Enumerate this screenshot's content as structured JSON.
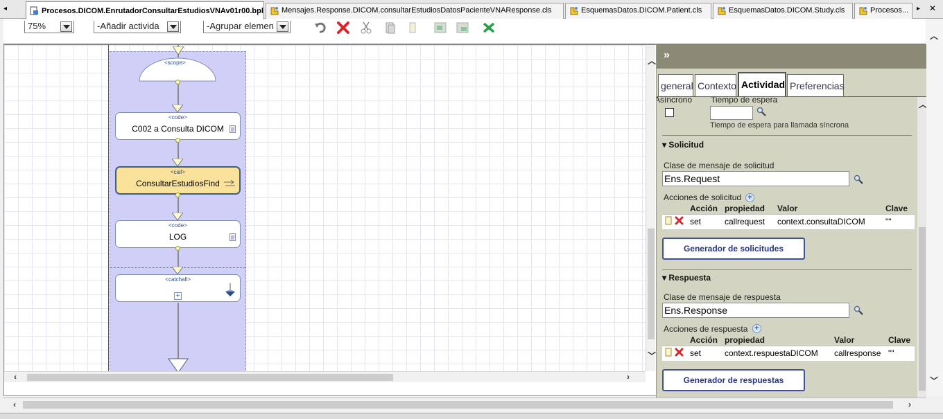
{
  "tabs": {
    "items": [
      {
        "label": "Procesos.DICOM.EnrutadorConsultarEstudiosVNAv01r00.bpl",
        "active": true
      },
      {
        "label": "Mensajes.Response.DICOM.consultarEstudiosDatosPacienteVNAResponse.cls",
        "active": false
      },
      {
        "label": "EsquemasDatos.DICOM.Patient.cls",
        "active": false
      },
      {
        "label": "EsquemasDatos.DICOM.Study.cls",
        "active": false
      },
      {
        "label": "Procesos...",
        "active": false
      }
    ],
    "nav_left": "◂",
    "nav_right": "▸",
    "close": "✕"
  },
  "toolbar": {
    "zoom_value": "75%",
    "add_activity_value": "-Añadir activida",
    "group_value": "-Agrupar elemen",
    "icons": [
      "undo-icon",
      "delete-icon",
      "cut-icon",
      "copy-icon",
      "paste-icon",
      "group-icon",
      "ungroup-icon",
      "arrange-icon"
    ]
  },
  "diagram": {
    "scope": {
      "stereotype": "<scope>"
    },
    "activities": [
      {
        "stereotype": "<code>",
        "name": "C002 a Consulta DICOM",
        "highlight": false
      },
      {
        "stereotype": "<call>",
        "name": "ConsultarEstudiosFind",
        "highlight": true
      },
      {
        "stereotype": "<code>",
        "name": "LOG",
        "highlight": false
      },
      {
        "stereotype": "<catchall>",
        "name": "",
        "highlight": false
      }
    ],
    "catchall_expand": "+"
  },
  "panel": {
    "collapse_glyph": "»",
    "tabs": [
      "general",
      "Contexto",
      "Actividad",
      "Preferencias"
    ],
    "active_tab": "Actividad",
    "async_label": "Asíncrono",
    "wait_label": "Tiempo de espera",
    "wait_value": "",
    "wait_hint": "Tiempo de espera para llamada síncrona",
    "request": {
      "section_title": "Solicitud",
      "class_label": "Clase de mensaje de solicitud",
      "class_value": "Ens.Request",
      "actions_label": "Acciones de solicitud",
      "columns": [
        "Acción",
        "propiedad",
        "Valor",
        "Clave"
      ],
      "rows": [
        {
          "action": "set",
          "property": "callrequest",
          "value": "context.consultaDICOM",
          "key": "\"\""
        }
      ],
      "button": "Generador de solicitudes"
    },
    "response": {
      "section_title": "Respuesta",
      "class_label": "Clase de mensaje de respuesta",
      "class_value": "Ens.Response",
      "actions_label": "Acciones de respuesta",
      "columns": [
        "Acción",
        "propiedad",
        "Valor",
        "Clave"
      ],
      "rows": [
        {
          "action": "set",
          "property": "context.respuestaDICOM",
          "value": "callresponse",
          "key": "\"\""
        }
      ],
      "button": "Generador de respuestas"
    }
  },
  "colors": {
    "scope_band": "#cfcff7",
    "highlight_activity": "#fbe29a",
    "panel_bg": "#d4d4c2",
    "panel_header": "#8a8a77",
    "button_border": "#3f4fa0",
    "delete_red": "#d9262b",
    "green_icon": "#2aa04a"
  }
}
